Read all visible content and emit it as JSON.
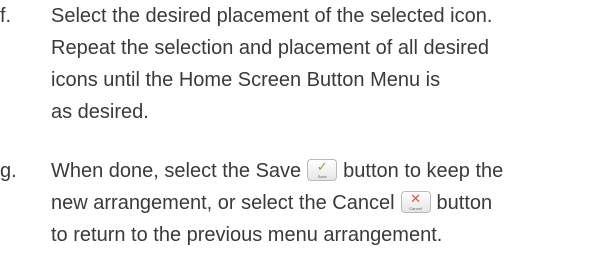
{
  "steps": [
    {
      "letter": "f.",
      "lines": [
        "Select the desired placement of the selected icon.",
        "Repeat the selection and placement of all desired",
        "icons until the Home Screen Button Menu is",
        "as desired."
      ]
    },
    {
      "letter": "g.",
      "line1_before": "When done, select the Save",
      "line1_after": "button to keep the",
      "line2_before": "new arrangement, or select the Cancel",
      "line2_after": "button",
      "line3": "to return to the previous menu arrangement."
    }
  ],
  "buttons": {
    "save": {
      "glyph": "✓",
      "caption": "Save",
      "icon": "checkmark-icon",
      "color": "#7aa83a"
    },
    "cancel": {
      "glyph": "✕",
      "caption": "Cancel",
      "icon": "x-icon",
      "color": "#e0533a"
    }
  }
}
